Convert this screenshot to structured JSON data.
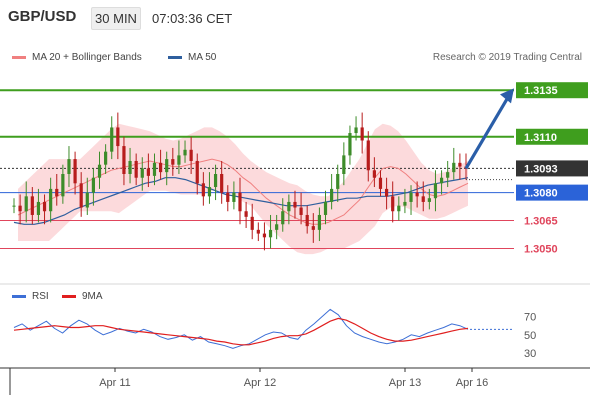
{
  "header": {
    "symbol": "GBP/USD",
    "timeframe": "30 MIN",
    "time": "07:03:36 CET"
  },
  "legend": {
    "bollinger": "MA 20 + Bollinger Bands",
    "ma50": "MA 50",
    "credit": "Research © 2019 Trading Central"
  },
  "rsi_legend": {
    "rsi": "RSI",
    "ma9": "9MA"
  },
  "colors": {
    "resistance": "#3f9e1e",
    "pivot": "#2b63d8",
    "support": "#e0455c",
    "current": "#333333",
    "arrow": "#2a5ea8",
    "bollinger_fill": "#fbd3d6",
    "ma50": "#2f5f9e",
    "rsi": "#3d6fd6",
    "rsi_ma": "#e01f1f"
  },
  "chart_data": [
    {
      "type": "line",
      "title": "GBP/USD 30 MIN",
      "x_ticks": [
        "Apr 11",
        "Apr 12",
        "Apr 13",
        "Apr 16"
      ],
      "ylim": [
        1.3032,
        1.3148
      ],
      "levels": [
        {
          "name": "resistance",
          "value": 1.3135,
          "label": "1.3135"
        },
        {
          "name": "resistance",
          "value": 1.311,
          "label": "1.3110"
        },
        {
          "name": "current",
          "value": 1.3093,
          "label": "1.3093"
        },
        {
          "name": "pivot",
          "value": 1.308,
          "label": "1.3080"
        },
        {
          "name": "support",
          "value": 1.3065,
          "label": "1.3065"
        },
        {
          "name": "support",
          "value": 1.305,
          "label": "1.3050"
        }
      ],
      "price": [
        1.3073,
        1.307,
        1.3078,
        1.3068,
        1.3075,
        1.307,
        1.3082,
        1.3078,
        1.309,
        1.3098,
        1.3085,
        1.3072,
        1.308,
        1.3088,
        1.3095,
        1.3102,
        1.3115,
        1.3105,
        1.309,
        1.3097,
        1.3088,
        1.3093,
        1.3089,
        1.3096,
        1.3091,
        1.3098,
        1.3095,
        1.31,
        1.3103,
        1.3097,
        1.3085,
        1.3078,
        1.3083,
        1.309,
        1.308,
        1.3075,
        1.308,
        1.307,
        1.3067,
        1.306,
        1.3058,
        1.3056,
        1.306,
        1.3063,
        1.307,
        1.3075,
        1.3072,
        1.3068,
        1.3062,
        1.306,
        1.3068,
        1.3075,
        1.3082,
        1.309,
        1.31,
        1.3112,
        1.3115,
        1.3108,
        1.3092,
        1.3088,
        1.3082,
        1.3078,
        1.307,
        1.3073,
        1.3075,
        1.308,
        1.3078,
        1.3075,
        1.3077,
        1.3085,
        1.3088,
        1.3091,
        1.3096,
        1.3094,
        1.3093
      ],
      "ma20": [
        1.3068,
        1.307,
        1.3072,
        1.3074,
        1.3076,
        1.3078,
        1.308,
        1.3082,
        1.3084,
        1.3086,
        1.3088,
        1.309,
        1.3092,
        1.3093,
        1.3094,
        1.3095,
        1.3096,
        1.3097,
        1.3096,
        1.3095,
        1.3094,
        1.3094,
        1.3095,
        1.3096,
        1.3097,
        1.3098,
        1.3097,
        1.3095,
        1.3092,
        1.3088,
        1.3085,
        1.3081,
        1.3077,
        1.3074,
        1.3071,
        1.3068,
        1.3066,
        1.3064,
        1.3063,
        1.3063,
        1.3064,
        1.3066,
        1.3068,
        1.3072,
        1.3076,
        1.3082,
        1.3088,
        1.3093,
        1.3094,
        1.3093,
        1.309,
        1.3086,
        1.3082,
        1.3079,
        1.3078,
        1.3079,
        1.3081,
        1.3083,
        1.3085
      ],
      "ma50": [
        1.3064,
        1.3063,
        1.3063,
        1.3064,
        1.3066,
        1.3068,
        1.3071,
        1.3073,
        1.3075,
        1.3077,
        1.3079,
        1.3081,
        1.3083,
        1.3085,
        1.3086,
        1.3088,
        1.3088,
        1.3087,
        1.3085,
        1.3083,
        1.3081,
        1.3079,
        1.3078,
        1.3077,
        1.3076,
        1.3075,
        1.3074,
        1.3073,
        1.3073,
        1.3073,
        1.3074,
        1.3075,
        1.3076,
        1.3077,
        1.3077,
        1.3078,
        1.3078,
        1.3078,
        1.3079,
        1.308,
        1.3082,
        1.3084,
        1.3085,
        1.3086,
        1.3087,
        1.3088
      ]
    },
    {
      "type": "line",
      "title": "RSI",
      "ylim": [
        20,
        85
      ],
      "y_ticks": [
        30,
        50,
        70
      ],
      "rsi": [
        58,
        62,
        55,
        60,
        65,
        57,
        52,
        60,
        66,
        62,
        55,
        50,
        53,
        57,
        54,
        52,
        56,
        53,
        48,
        45,
        47,
        50,
        44,
        48,
        42,
        40,
        38,
        35,
        38,
        40,
        45,
        50,
        53,
        52,
        47,
        45,
        55,
        62,
        70,
        78,
        72,
        60,
        52,
        48,
        45,
        42,
        40,
        42,
        45,
        50,
        48,
        52,
        55,
        58,
        62,
        60,
        56
      ],
      "ma9": [
        55,
        56,
        57,
        58,
        59,
        60,
        59,
        58,
        58,
        59,
        60,
        60,
        58,
        56,
        55,
        54,
        53,
        52,
        51,
        50,
        49,
        48,
        47,
        46,
        45,
        43,
        42,
        40,
        39,
        39,
        41,
        43,
        46,
        48,
        49,
        49,
        51,
        55,
        60,
        65,
        68,
        66,
        62,
        57,
        52,
        48,
        45,
        43,
        43,
        44,
        46,
        48,
        50,
        52,
        54,
        56,
        57
      ]
    }
  ]
}
